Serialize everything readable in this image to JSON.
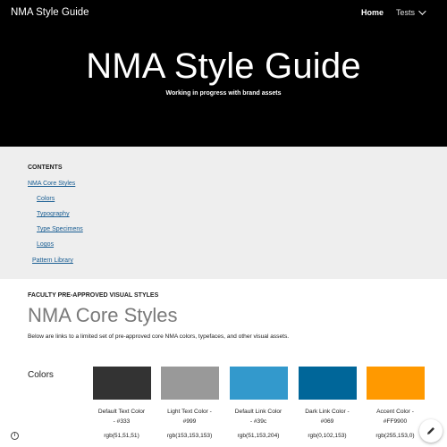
{
  "header": {
    "site_name": "NMA Style Guide",
    "nav": {
      "home": "Home",
      "tests": "Tests"
    }
  },
  "hero": {
    "title": "NMA Style Guide",
    "subtitle": "Working in progress with brand assets"
  },
  "toc": {
    "heading": "CONTENTS",
    "items": [
      {
        "label": "NMA Core Styles"
      },
      {
        "label": "Colors"
      },
      {
        "label": "Typography"
      },
      {
        "label": "Type Specimens"
      },
      {
        "label": "Logos"
      },
      {
        "label": "Pattern Library"
      }
    ]
  },
  "section": {
    "eyebrow": "FACULTY PRE-APPROVED VISUAL STYLES",
    "title": "NMA Core Styles",
    "description": "Below are links to a limited set of pre-approved core NMA colors, typefaces, and other visual assets.",
    "colors_label": "Colors"
  },
  "swatches": [
    {
      "line1": "Default Text Color",
      "line2": "- #333",
      "rgb": "rgb(51,51,51)",
      "hex": "#333333"
    },
    {
      "line1": "Light Text Color -",
      "line2": "#999",
      "rgb": "rgb(153,153,153)",
      "hex": "#999999"
    },
    {
      "line1": "Default Link Color",
      "line2": "- #39c",
      "rgb": "rgb(51,153,204)",
      "hex": "#3399cc"
    },
    {
      "line1": "Dark Link Color -",
      "line2": "#069",
      "rgb": "rgb(0,102,153)",
      "hex": "#006699"
    },
    {
      "line1": "Accent Color -",
      "line2": "#FF9900",
      "rgb": "rgb(255,153,0)",
      "hex": "#ff9900"
    }
  ]
}
